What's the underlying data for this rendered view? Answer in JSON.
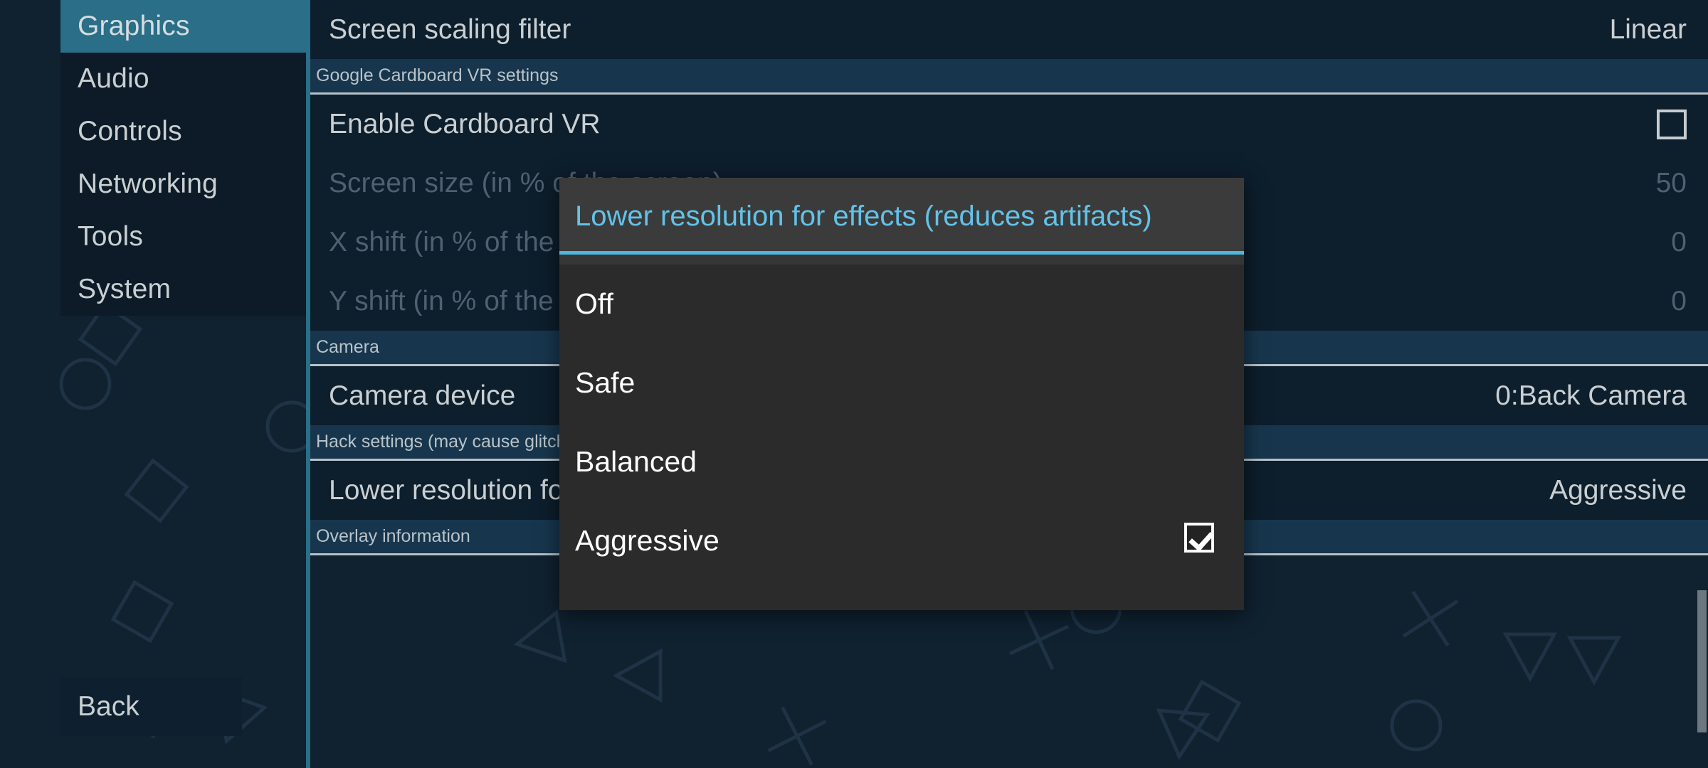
{
  "app": {
    "accent_teal": "#2a6e88",
    "accent_cyan": "#4cb8e0",
    "panel_bg": "#0d1e2c",
    "header_bg": "#17364d",
    "dialog_bg": "#2b2b2b"
  },
  "sidebar": {
    "items": [
      {
        "label": "Graphics",
        "selected": true
      },
      {
        "label": "Audio",
        "selected": false
      },
      {
        "label": "Controls",
        "selected": false
      },
      {
        "label": "Networking",
        "selected": false
      },
      {
        "label": "Tools",
        "selected": false
      },
      {
        "label": "System",
        "selected": false
      }
    ],
    "back_label": "Back"
  },
  "settings": {
    "rows": [
      {
        "type": "item",
        "label": "Screen scaling filter",
        "value": "Linear",
        "disabled": false,
        "control": "text"
      },
      {
        "type": "header",
        "label": "Google Cardboard VR settings"
      },
      {
        "type": "item",
        "label": "Enable Cardboard VR",
        "value": "",
        "disabled": false,
        "control": "checkbox",
        "checked": false
      },
      {
        "type": "item",
        "label": "Screen size (in % of the screen)",
        "value": "50",
        "disabled": true,
        "control": "text"
      },
      {
        "type": "item",
        "label": "X shift (in % of the screen)",
        "value": "0",
        "disabled": true,
        "control": "text"
      },
      {
        "type": "item",
        "label": "Y shift (in % of the screen)",
        "value": "0",
        "disabled": true,
        "control": "text"
      },
      {
        "type": "header",
        "label": "Camera"
      },
      {
        "type": "item",
        "label": "Camera device",
        "value": "0:Back Camera",
        "disabled": false,
        "control": "text"
      },
      {
        "type": "header",
        "label": "Hack settings (may cause glitches)"
      },
      {
        "type": "item",
        "label": "Lower resolution for effects (reduces artifacts)",
        "value": "Aggressive",
        "disabled": false,
        "control": "text"
      },
      {
        "type": "header",
        "label": "Overlay information"
      }
    ]
  },
  "dialog": {
    "title": "Lower resolution for effects (reduces artifacts)",
    "options": [
      {
        "label": "Off",
        "checked": false
      },
      {
        "label": "Safe",
        "checked": false
      },
      {
        "label": "Balanced",
        "checked": false
      },
      {
        "label": "Aggressive",
        "checked": true
      }
    ]
  },
  "scrollbar": {
    "visible": true
  }
}
